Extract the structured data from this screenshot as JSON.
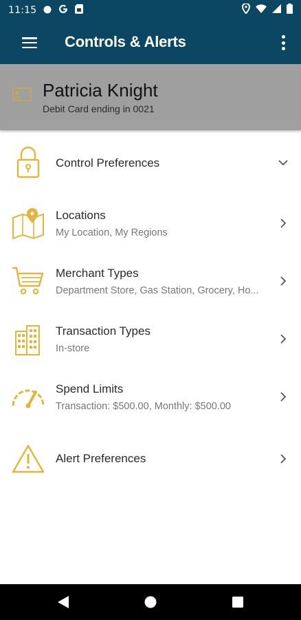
{
  "status_bar": {
    "time": "11:15",
    "icons": [
      "notification-dot-icon",
      "google-icon",
      "sim-card-icon",
      "location-icon",
      "wifi-icon",
      "signal-icon",
      "battery-icon"
    ]
  },
  "app_bar": {
    "title": "Controls & Alerts",
    "menu_icon": "hamburger-menu-icon",
    "overflow_icon": "more-vert-icon"
  },
  "card": {
    "name": "Patricia Knight",
    "subtitle": "Debit Card ending in 0021",
    "icon": "credit-card-icon"
  },
  "list": [
    {
      "title": "Control Preferences",
      "subtitle": "",
      "icon": "lock-icon",
      "chevron": "chevron-down-icon"
    },
    {
      "title": "Locations",
      "subtitle": "My Location, My Regions",
      "icon": "map-pin-icon",
      "chevron": "chevron-right-icon"
    },
    {
      "title": "Merchant Types",
      "subtitle": "Department Store, Gas Station, Grocery, Ho...",
      "icon": "shopping-cart-icon",
      "chevron": "chevron-right-icon"
    },
    {
      "title": "Transaction Types",
      "subtitle": "In-store",
      "icon": "buildings-icon",
      "chevron": "chevron-right-icon"
    },
    {
      "title": "Spend Limits",
      "subtitle": "Transaction: $500.00, Monthly: $500.00",
      "icon": "speedometer-icon",
      "chevron": "chevron-right-icon"
    },
    {
      "title": "Alert Preferences",
      "subtitle": "",
      "icon": "warning-icon",
      "chevron": "chevron-right-icon"
    }
  ],
  "colors": {
    "header_bg": "#0b4763",
    "card_bg": "#9f9f9f",
    "icon_accent": "#e5b53a",
    "nav_bg": "#000000"
  },
  "nav": {
    "back": "back-icon",
    "home": "home-icon",
    "recents": "recents-icon"
  }
}
